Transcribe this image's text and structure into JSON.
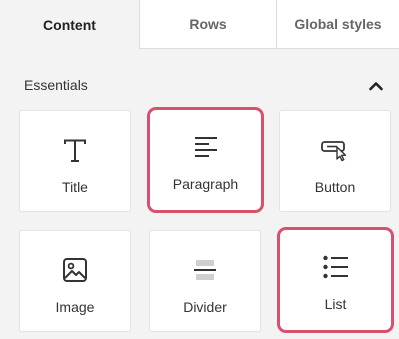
{
  "tabs": [
    {
      "label": "Content",
      "active": true
    },
    {
      "label": "Rows",
      "active": false
    },
    {
      "label": "Global styles",
      "active": false
    }
  ],
  "section": {
    "title": "Essentials",
    "toggle_icon": "chevron-up-icon",
    "expanded": true
  },
  "blocks": [
    {
      "label": "Title",
      "icon": "text-t-icon",
      "highlighted": false
    },
    {
      "label": "Paragraph",
      "icon": "paragraph-lines-icon",
      "highlighted": true
    },
    {
      "label": "Button",
      "icon": "button-cursor-icon",
      "highlighted": false
    },
    {
      "label": "Image",
      "icon": "image-icon",
      "highlighted": false
    },
    {
      "label": "Divider",
      "icon": "divider-icon",
      "highlighted": false
    },
    {
      "label": "List",
      "icon": "bulleted-list-icon",
      "highlighted": true
    }
  ],
  "colors": {
    "highlight": "#d8506c",
    "panel_background": "#f3f3f3",
    "tile_background": "#ffffff",
    "icon": "#333333",
    "divider_icon": "#b5b5b5"
  }
}
